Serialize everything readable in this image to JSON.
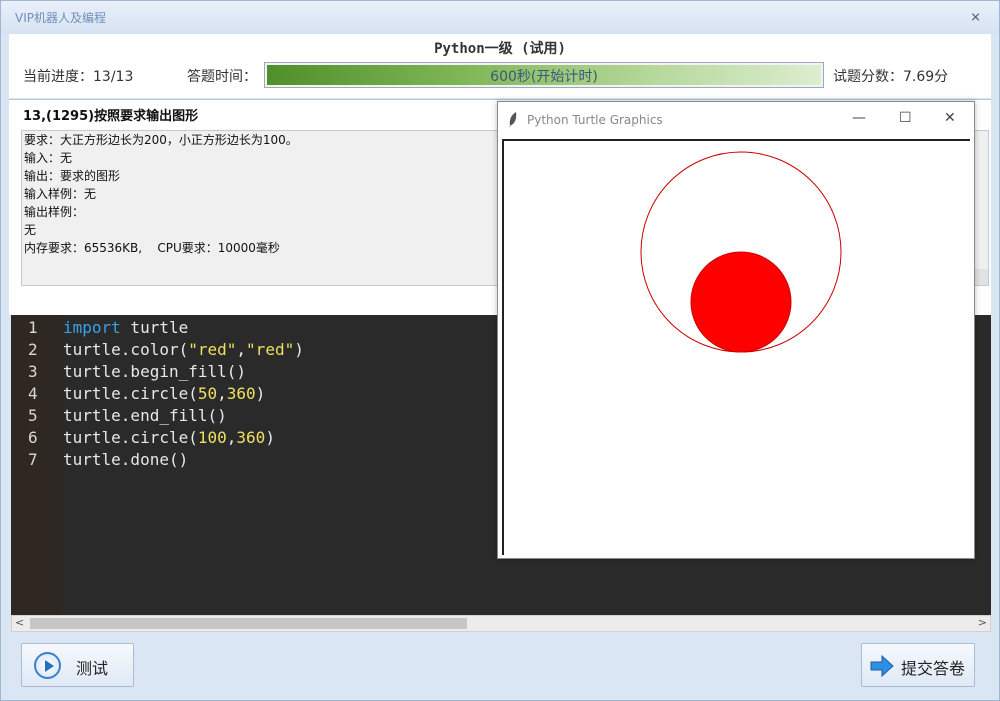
{
  "window": {
    "title": "VIP机器人及编程",
    "close_glyph": "⨯"
  },
  "header": {
    "exam_title": "Python一级 (试用)",
    "progress_label": "当前进度：13/13",
    "time_label": "答题时间：",
    "time_text": "600秒(开始计时)",
    "time_fill_fraction": 1.0,
    "score_label": "试题分数：7.69分"
  },
  "question": {
    "title": "13,(1295)按照要求输出图形",
    "lines": [
      "要求：大正方形边长为200，小正方形边长为100。",
      "输入：无",
      "输出：要求的图形",
      "输入样例：无",
      "输出样例：",
      "无",
      "内存要求：65536KB,    CPU要求：10000毫秒"
    ]
  },
  "editor": {
    "line_numbers": [
      "1",
      "2",
      "3",
      "4",
      "5",
      "6",
      "7"
    ],
    "code": {
      "l1_kw": "import",
      "l1_rest": " turtle",
      "l2_a": "turtle.color(",
      "l2_s1": "\"red\"",
      "l2_b": ",",
      "l2_s2": "\"red\"",
      "l2_c": ")",
      "l3": "turtle.begin_fill()",
      "l4_a": "turtle.circle(",
      "l4_n1": "50",
      "l4_b": ",",
      "l4_n2": "360",
      "l4_c": ")",
      "l5": "turtle.end_fill()",
      "l6_a": "turtle.circle(",
      "l6_n1": "100",
      "l6_b": ",",
      "l6_n2": "360",
      "l6_c": ")",
      "l7": "turtle.done()"
    }
  },
  "scrollbar": {
    "left_arrow": "<",
    "right_arrow": ">"
  },
  "buttons": {
    "test_label": "测试",
    "submit_label": "提交答卷"
  },
  "turtle_window": {
    "title": "Python Turtle Graphics",
    "minimize": "—",
    "maximize": "☐",
    "close": "✕",
    "pen_color": "#cc0000",
    "fill_color": "#ff0000"
  },
  "colors": {
    "keyword": "#3aa0e8",
    "string": "#f0e060",
    "editor_bg": "#2a2a2a"
  }
}
